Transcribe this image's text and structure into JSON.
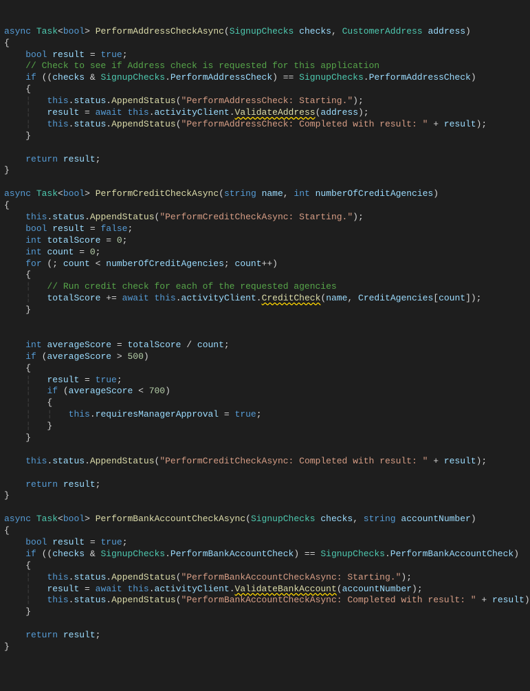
{
  "m1": {
    "sig_async": "async",
    "sig_task": "Task",
    "sig_bool": "bool",
    "sig_name": "PerformAddressCheckAsync",
    "p1_type": "SignupChecks",
    "p1": "checks",
    "p2_type": "CustomerAddress",
    "p2": "address",
    "l1_type": "bool",
    "l1_var": "result",
    "l1_lit": "true",
    "cmt": "// Check to see if Address check is requested for this application",
    "if_kw": "if",
    "enum": "SignupChecks",
    "enum_member": "PerformAddressCheck",
    "this": "this",
    "status": "status",
    "append": "AppendStatus",
    "s1": "\"PerformAddressCheck: Starting.\"",
    "await": "await",
    "client": "activityClient",
    "call": "ValidateAddress",
    "s2": "\"PerformAddressCheck: Completed with result: \"",
    "ret": "return"
  },
  "m2": {
    "sig_async": "async",
    "sig_task": "Task",
    "sig_bool": "bool",
    "sig_name": "PerformCreditCheckAsync",
    "p1_type": "string",
    "p1": "name",
    "p2_type": "int",
    "p2": "numberOfCreditAgencies",
    "this": "this",
    "status": "status",
    "append": "AppendStatus",
    "s1": "\"PerformCreditCheckAsync: Starting.\"",
    "res_type": "bool",
    "res": "result",
    "false": "false",
    "ts_type": "int",
    "ts": "totalScore",
    "zero": "0",
    "cnt_type": "int",
    "cnt": "count",
    "for": "for",
    "cmt": "// Run credit check for each of the requested agencies",
    "await": "await",
    "client": "activityClient",
    "call": "CreditCheck",
    "agencies": "CreditAgencies",
    "avg_type": "int",
    "avg": "averageScore",
    "if": "if",
    "th500": "500",
    "true": "true",
    "th700": "700",
    "rma": "requiresManagerApproval",
    "s2": "\"PerformCreditCheckAsync: Completed with result: \"",
    "ret": "return"
  },
  "m3": {
    "sig_async": "async",
    "sig_task": "Task",
    "sig_bool": "bool",
    "sig_name": "PerformBankAccountCheckAsync",
    "p1_type": "SignupChecks",
    "p1": "checks",
    "p2_type": "string",
    "p2": "accountNumber",
    "res_type": "bool",
    "res": "result",
    "true": "true",
    "if": "if",
    "enum": "SignupChecks",
    "enum_member": "PerformBankAccountCheck",
    "this": "this",
    "status": "status",
    "append": "AppendStatus",
    "s1": "\"PerformBankAccountCheckAsync: Starting.\"",
    "await": "await",
    "client": "activityClient",
    "call": "ValidateBankAccount",
    "s2": "\"PerformBankAccountCheckAsync: Completed with result: \"",
    "ret": "return"
  }
}
